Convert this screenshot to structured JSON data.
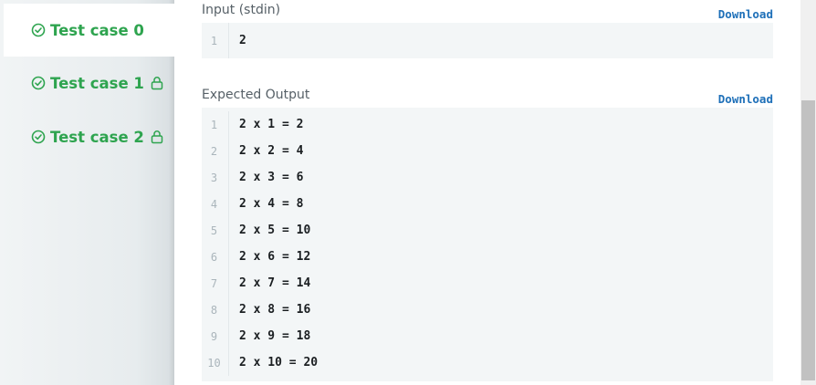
{
  "sidebar": {
    "tabs": [
      {
        "label": "Test case 0",
        "locked": false,
        "active": true
      },
      {
        "label": "Test case 1",
        "locked": true,
        "active": false
      },
      {
        "label": "Test case 2",
        "locked": true,
        "active": false
      }
    ]
  },
  "input_section": {
    "label": "Input (stdin)",
    "download_label": "Download",
    "lines": [
      {
        "num": "1",
        "text": "2"
      }
    ]
  },
  "output_section": {
    "label": "Expected Output",
    "download_label": "Download",
    "lines": [
      {
        "num": "1",
        "text": "2 x 1 = 2"
      },
      {
        "num": "2",
        "text": "2 x 2 = 4"
      },
      {
        "num": "3",
        "text": "2 x 3 = 6"
      },
      {
        "num": "4",
        "text": "2 x 4 = 8"
      },
      {
        "num": "5",
        "text": "2 x 5 = 10"
      },
      {
        "num": "6",
        "text": "2 x 6 = 12"
      },
      {
        "num": "7",
        "text": "2 x 7 = 14"
      },
      {
        "num": "8",
        "text": "2 x 8 = 16"
      },
      {
        "num": "9",
        "text": "2 x 9 = 18"
      },
      {
        "num": "10",
        "text": "2 x 10 = 20"
      }
    ]
  },
  "colors": {
    "success_green": "#2ea44f",
    "link_blue": "#1d6fb8",
    "code_bg": "#f3f6f7"
  },
  "icons": {
    "tab_status": "check-circle-icon",
    "tab_lock": "lock-icon"
  }
}
